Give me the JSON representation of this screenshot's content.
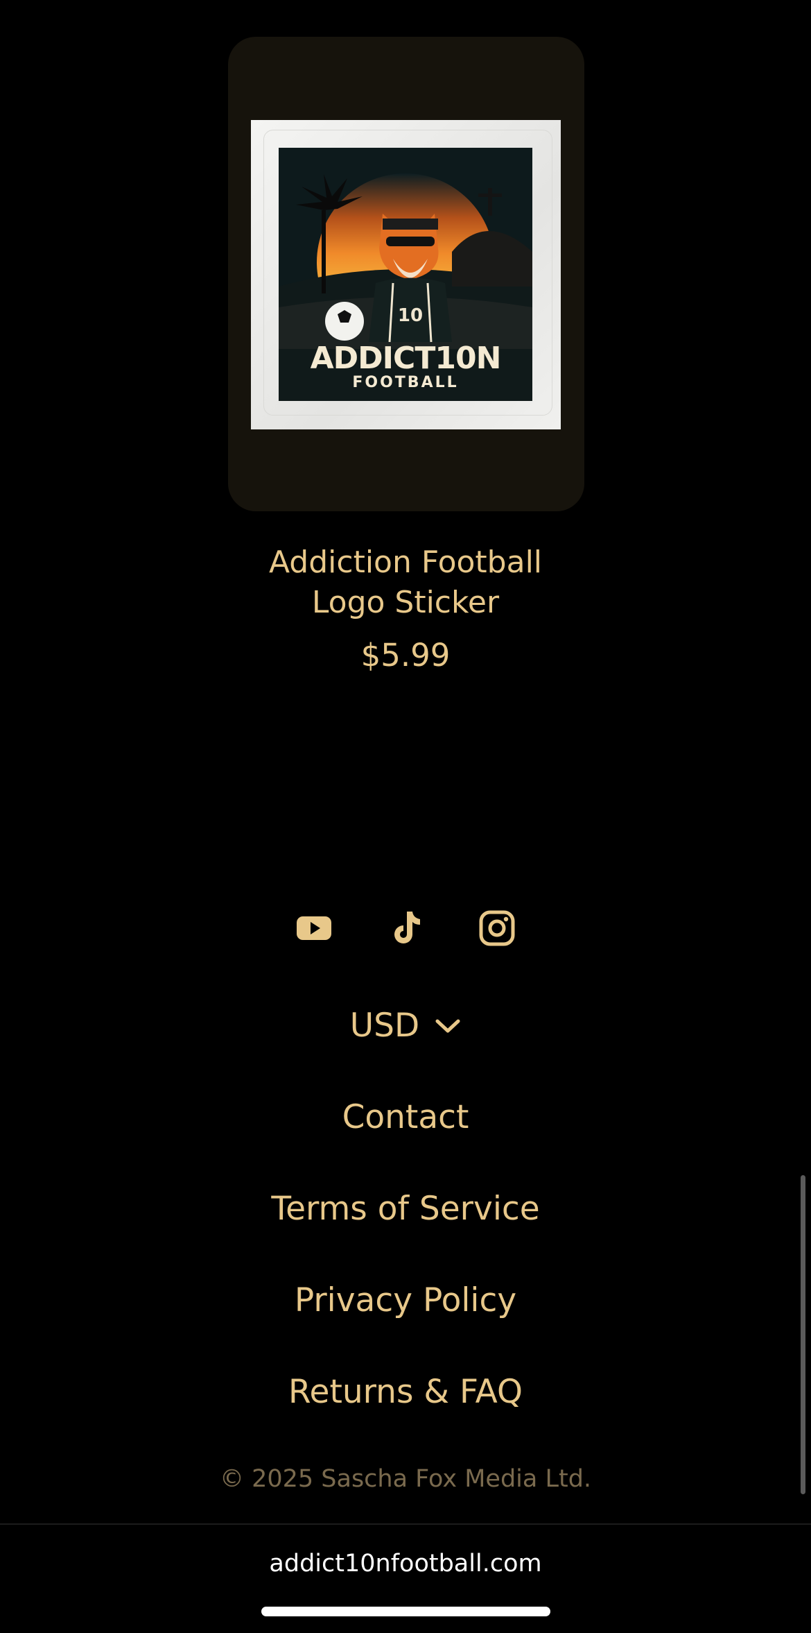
{
  "product": {
    "title_line1": "Addiction Football",
    "title_line2": "Logo Sticker",
    "price": "$5.99",
    "image": {
      "wordmark_main": "ADDICT10N",
      "wordmark_sub": "FOOTBALL",
      "jersey_number": "10"
    }
  },
  "social": {
    "icons": [
      "youtube-icon",
      "tiktok-icon",
      "instagram-icon"
    ]
  },
  "currency": {
    "label": "USD",
    "icon": "chevron-down-icon"
  },
  "footer": {
    "links": [
      "Contact",
      "Terms of Service",
      "Privacy Policy",
      "Returns & FAQ"
    ],
    "copyright": "© 2025 Sascha Fox Media Ltd."
  },
  "browser": {
    "address": "addict10nfootball.com"
  },
  "colors": {
    "accent": "#e8c88a",
    "background": "#000000",
    "card": "#16130c",
    "muted": "#7a6a4e"
  }
}
